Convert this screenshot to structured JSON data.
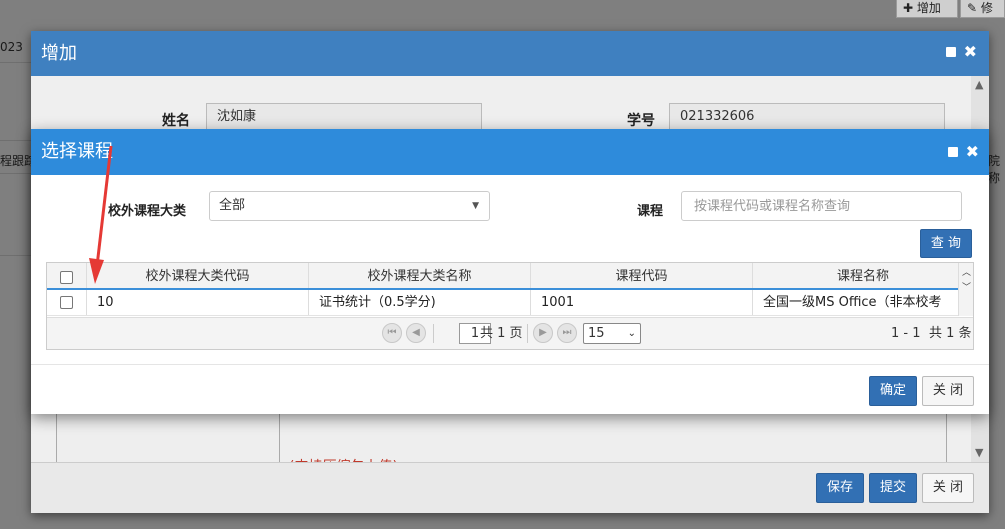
{
  "background": {
    "toolbar_add": "增加",
    "toolbar_edit": "修",
    "frag_left_top": "023",
    "frag_left_mid": "程跟踪",
    "frag_right_mid": "院称"
  },
  "outer_modal": {
    "title": "增加",
    "name_label": "姓名",
    "name_value": "沈如康",
    "student_id_label": "学号",
    "student_id_value": "021332606",
    "upload_note": "(支持压缩包上传)",
    "save_label": "保存",
    "submit_label": "提交",
    "close_label": "关 闭"
  },
  "course_modal": {
    "title": "选择课程",
    "category_label": "校外课程大类",
    "category_selected": "全部",
    "course_label": "课程",
    "course_placeholder": "按课程代码或课程名称查询",
    "query_label": "查 询",
    "columns": [
      "校外课程大类代码",
      "校外课程大类名称",
      "课程代码",
      "课程名称"
    ],
    "rows": [
      {
        "category_code": "10",
        "category_name": "证书统计（0.5学分)",
        "course_code": "1001",
        "course_name": "全国一级MS Office（非本校考证)"
      }
    ],
    "pager": {
      "current_page": "1",
      "total_pages_text": "共 1 页",
      "page_size": "15",
      "range_text": "1 - 1",
      "total_text": "共 1 条"
    },
    "confirm_label": "确定",
    "close_label": "关 闭"
  },
  "annotation": {
    "arrow_color": "#e53935"
  },
  "colors": {
    "outer_header": "#3f80c0",
    "inner_header": "#2e8bdb",
    "primary_button": "#3270b4"
  }
}
